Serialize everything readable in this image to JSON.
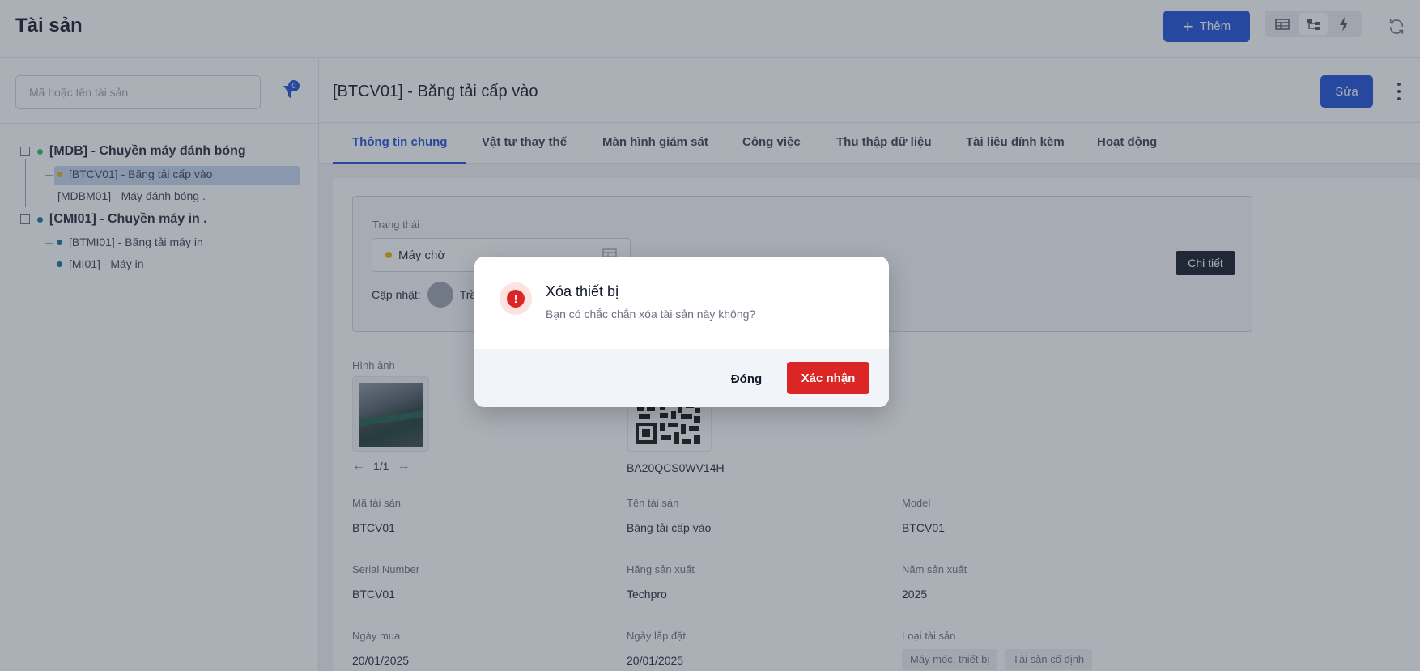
{
  "header": {
    "title": "Tài sản",
    "add_label": "Thêm",
    "views": [
      "table-icon",
      "tree-icon",
      "lightning-icon"
    ],
    "active_view": "tree-icon"
  },
  "sidebar": {
    "search_placeholder": "Mã hoặc tên tài sản",
    "filter_count": "0",
    "tree": [
      {
        "label": "[MDB] - Chuyền máy đánh bóng",
        "status_color": "#22c55e",
        "children": [
          {
            "label": "[BTCV01] - Băng tải cấp vào",
            "status_color": "#eab308",
            "selected": true
          },
          {
            "label": "[MDBM01] - Máy đánh bóng ."
          }
        ]
      },
      {
        "label": "[CMI01] - Chuyền máy in .",
        "status_color": "#0e7490",
        "children": [
          {
            "label": "[BTMI01] - Băng tải máy in",
            "status_color": "#0e7490"
          },
          {
            "label": "[MI01] - Máy in",
            "status_color": "#0e7490"
          }
        ]
      }
    ]
  },
  "detail": {
    "title": "[BTCV01] - Băng tải cấp vào",
    "edit_label": "Sửa",
    "tabs": [
      "Thông tin chung",
      "Vật tư thay thế",
      "Màn hình giám sát",
      "Công việc",
      "Thu thập dữ liệu",
      "Tài liệu đính kèm",
      "Hoạt động"
    ],
    "active_tab": 0,
    "status": {
      "label": "Trạng thái",
      "value": "Máy chờ",
      "dot_color": "#eab308",
      "update_label": "Cập nhật:",
      "update_user": "Trầ",
      "detail_button": "Chi tiết"
    },
    "image_label": "Hình ảnh",
    "image_pager": "1/1",
    "qr_code": "BA20QCS0WV14H",
    "fields": [
      {
        "label": "Mã tài sản",
        "value": "BTCV01"
      },
      {
        "label": "Tên tài sản",
        "value": "Băng tải cấp vào"
      },
      {
        "label": "Model",
        "value": "BTCV01"
      },
      {
        "label": "Serial Number",
        "value": "BTCV01"
      },
      {
        "label": "Hãng sản xuất",
        "value": "Techpro"
      },
      {
        "label": "Năm sản xuất",
        "value": "2025"
      },
      {
        "label": "Ngày mua",
        "value": "20/01/2025"
      },
      {
        "label": "Ngày lắp đặt",
        "value": "20/01/2025"
      },
      {
        "label": "Loại tài sản",
        "value": ""
      }
    ],
    "asset_types": [
      "Máy móc, thiết bị",
      "Tài sản cố định"
    ]
  },
  "modal": {
    "title": "Xóa thiết bị",
    "message": "Bạn có chắc chắn xóa tài sản này không?",
    "close_label": "Đóng",
    "confirm_label": "Xác nhận"
  }
}
